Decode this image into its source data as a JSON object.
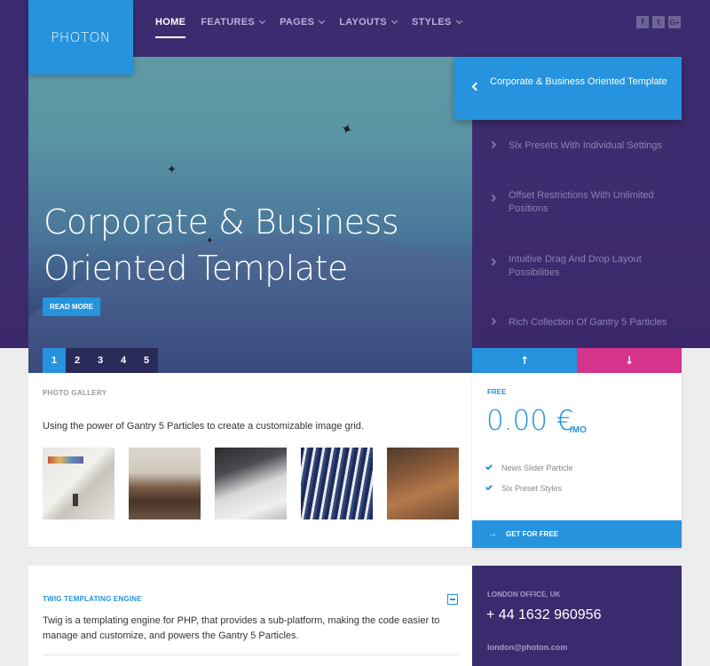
{
  "logo": "PHOTON",
  "nav": [
    {
      "label": "HOME",
      "active": true,
      "dropdown": false
    },
    {
      "label": "FEATURES",
      "active": false,
      "dropdown": true
    },
    {
      "label": "PAGES",
      "active": false,
      "dropdown": true
    },
    {
      "label": "LAYOUTS",
      "active": false,
      "dropdown": true
    },
    {
      "label": "STYLES",
      "active": false,
      "dropdown": true
    }
  ],
  "social": [
    "facebook-icon",
    "twitter-icon",
    "google-plus-icon"
  ],
  "social_glyphs": [
    "f",
    "t",
    "G+"
  ],
  "slider": {
    "title": "Corporate & Business Oriented Template",
    "read_more": "READ MORE",
    "pages": [
      "1",
      "2",
      "3",
      "4",
      "5"
    ],
    "active_page": 1,
    "items": [
      {
        "label": "Corporate & Business Oriented Template",
        "active": true
      },
      {
        "label": "Six Presets With Individual Settings",
        "active": false
      },
      {
        "label": "Offset Restrictions With Unlimited Positions",
        "active": false
      },
      {
        "label": "Intuitive Drag And Drop Layout Possibilities",
        "active": false
      },
      {
        "label": "Rich Collection Of Gantry 5 Particles",
        "active": false
      }
    ]
  },
  "gallery": {
    "label": "PHOTO GALLERY",
    "description": "Using the power of Gantry 5 Particles to create a customizable image grid."
  },
  "pricing": {
    "tier": "FREE",
    "price": "0.00 €",
    "period": "/MO",
    "features": [
      "News Slider Particle",
      "Six Preset Styles"
    ],
    "cta": "GET FOR FREE"
  },
  "twig": {
    "heading": "TWIG TEMPLATING ENGINE",
    "body": "Twig is a templating engine for PHP, that provides a sub-platform, making the code easier to manage and customize, and powers the Gantry 5 Particles."
  },
  "office": {
    "label": "LONDON OFFICE, UK",
    "phone": "+ 44 1632 960956",
    "email": "london@photon.com"
  },
  "colors": {
    "accent": "#2593dd",
    "brand_purple": "#3a2a6e",
    "pink": "#d6338c"
  }
}
